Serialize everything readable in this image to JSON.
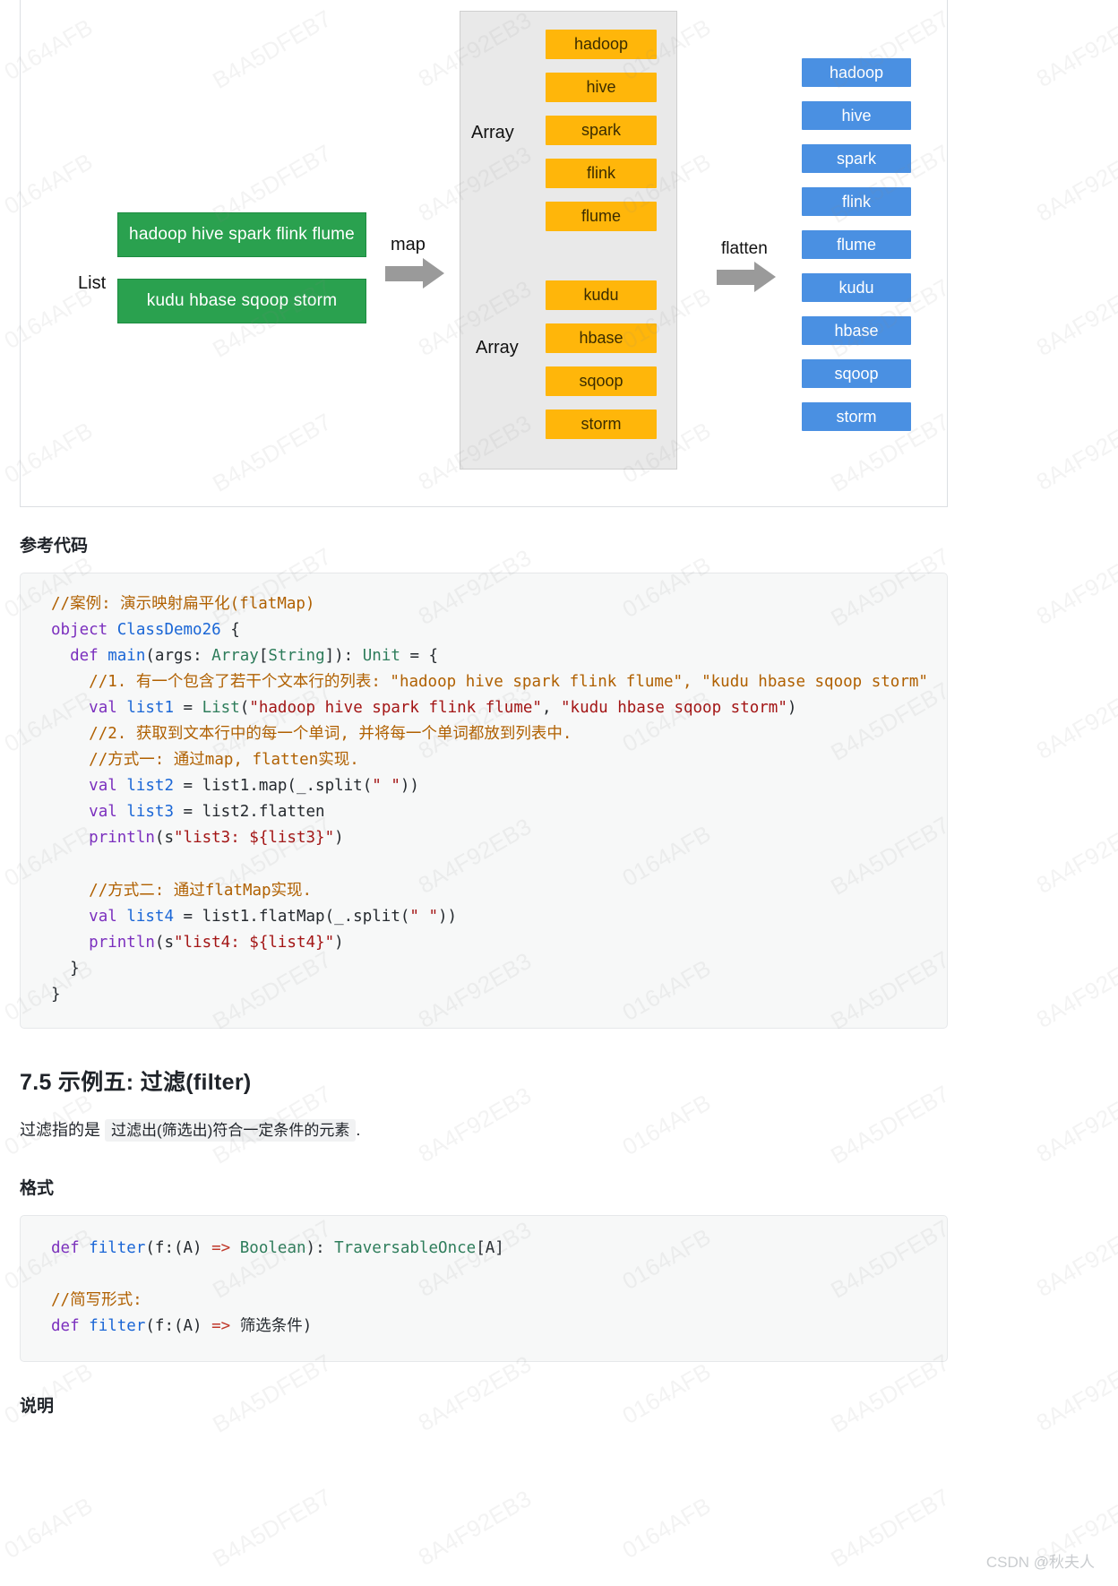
{
  "diagram": {
    "list_label": "List",
    "array_label_top": "Array",
    "array_label_bottom": "Array",
    "map_label": "map",
    "flatten_label": "flatten",
    "green_boxes": [
      "hadoop hive spark flink flume",
      "kudu hbase sqoop storm"
    ],
    "array_top_items": [
      "hadoop",
      "hive",
      "spark",
      "flink",
      "flume"
    ],
    "array_bottom_items": [
      "kudu",
      "hbase",
      "sqoop",
      "storm"
    ],
    "flattened_items": [
      "hadoop",
      "hive",
      "spark",
      "flink",
      "flume",
      "kudu",
      "hbase",
      "sqoop",
      "storm"
    ],
    "colors": {
      "green": "#2aa14f",
      "orange": "#ffb60a",
      "blue": "#4a90e2",
      "panel": "#e9e9e9",
      "arrow": "#9a9a9a"
    }
  },
  "sections": {
    "reference_code_heading": "参考代码",
    "filter_section_heading": "7.5 示例五: 过滤(filter)",
    "filter_desc_before": "过滤指的是",
    "filter_desc_highlight": "过滤出(筛选出)符合一定条件的元素",
    "filter_desc_after": ".",
    "format_heading": "格式",
    "explain_heading": "说明"
  },
  "code1": {
    "lines": [
      [
        {
          "t": "//案例: 演示映射扁平化(flatMap)",
          "c": "cmt"
        }
      ],
      [
        {
          "t": "object ",
          "c": "kw"
        },
        {
          "t": "ClassDemo26",
          "c": "fn"
        },
        {
          "t": " {",
          "c": "pl"
        }
      ],
      [
        {
          "t": "  def ",
          "c": "kw"
        },
        {
          "t": "main",
          "c": "fn"
        },
        {
          "t": "(args: ",
          "c": "pl"
        },
        {
          "t": "Array",
          "c": "typ"
        },
        {
          "t": "[",
          "c": "pl"
        },
        {
          "t": "String",
          "c": "typ"
        },
        {
          "t": "]): ",
          "c": "pl"
        },
        {
          "t": "Unit",
          "c": "typ"
        },
        {
          "t": " = {",
          "c": "pl"
        }
      ],
      [
        {
          "t": "    //1. 有一个包含了若干个文本行的列表: \"hadoop hive spark flink flume\", \"kudu hbase sqoop storm\"",
          "c": "cmt"
        }
      ],
      [
        {
          "t": "    ",
          "c": "pl"
        },
        {
          "t": "val ",
          "c": "kw"
        },
        {
          "t": "list1",
          "c": "fn"
        },
        {
          "t": " = ",
          "c": "pl"
        },
        {
          "t": "List",
          "c": "typ"
        },
        {
          "t": "(",
          "c": "pl"
        },
        {
          "t": "\"hadoop hive spark flink flume\"",
          "c": "str"
        },
        {
          "t": ", ",
          "c": "pl"
        },
        {
          "t": "\"kudu hbase sqoop storm\"",
          "c": "str"
        },
        {
          "t": ")",
          "c": "pl"
        }
      ],
      [
        {
          "t": "    //2. 获取到文本行中的每一个单词, 并将每一个单词都放到列表中.",
          "c": "cmt"
        }
      ],
      [
        {
          "t": "    //方式一: 通过map, flatten实现.",
          "c": "cmt"
        }
      ],
      [
        {
          "t": "    ",
          "c": "pl"
        },
        {
          "t": "val ",
          "c": "kw"
        },
        {
          "t": "list2",
          "c": "fn"
        },
        {
          "t": " = list1.map(_.split(",
          "c": "pl"
        },
        {
          "t": "\" \"",
          "c": "str"
        },
        {
          "t": "))",
          "c": "pl"
        }
      ],
      [
        {
          "t": "    ",
          "c": "pl"
        },
        {
          "t": "val ",
          "c": "kw"
        },
        {
          "t": "list3",
          "c": "fn"
        },
        {
          "t": " = list2.flatten",
          "c": "pl"
        }
      ],
      [
        {
          "t": "    ",
          "c": "pl"
        },
        {
          "t": "println",
          "c": "kw"
        },
        {
          "t": "(s",
          "c": "pl"
        },
        {
          "t": "\"list3: ${list3}\"",
          "c": "str"
        },
        {
          "t": ")",
          "c": "pl"
        }
      ],
      [
        {
          "t": "",
          "c": "pl"
        }
      ],
      [
        {
          "t": "    //方式二: 通过flatMap实现.",
          "c": "cmt"
        }
      ],
      [
        {
          "t": "    ",
          "c": "pl"
        },
        {
          "t": "val ",
          "c": "kw"
        },
        {
          "t": "list4",
          "c": "fn"
        },
        {
          "t": " = list1.flatMap(_.split(",
          "c": "pl"
        },
        {
          "t": "\" \"",
          "c": "str"
        },
        {
          "t": "))",
          "c": "pl"
        }
      ],
      [
        {
          "t": "    ",
          "c": "pl"
        },
        {
          "t": "println",
          "c": "kw"
        },
        {
          "t": "(s",
          "c": "pl"
        },
        {
          "t": "\"list4: ${list4}\"",
          "c": "str"
        },
        {
          "t": ")",
          "c": "pl"
        }
      ],
      [
        {
          "t": "  }",
          "c": "pl"
        }
      ],
      [
        {
          "t": "}",
          "c": "pl"
        }
      ]
    ]
  },
  "code2": {
    "lines": [
      [
        {
          "t": "def ",
          "c": "kw"
        },
        {
          "t": "filter",
          "c": "fn"
        },
        {
          "t": "(f:(A) ",
          "c": "pl"
        },
        {
          "t": "=>",
          "c": "op"
        },
        {
          "t": " ",
          "c": "pl"
        },
        {
          "t": "Boolean",
          "c": "typ"
        },
        {
          "t": "): ",
          "c": "pl"
        },
        {
          "t": "TraversableOnce",
          "c": "typ"
        },
        {
          "t": "[A]",
          "c": "pl"
        }
      ],
      [
        {
          "t": "",
          "c": "pl"
        }
      ],
      [
        {
          "t": "//简写形式:",
          "c": "cmt"
        }
      ],
      [
        {
          "t": "def ",
          "c": "kw"
        },
        {
          "t": "filter",
          "c": "fn"
        },
        {
          "t": "(f:(A) ",
          "c": "pl"
        },
        {
          "t": "=>",
          "c": "op"
        },
        {
          "t": " 筛选条件)",
          "c": "pl"
        }
      ]
    ]
  },
  "footer": {
    "watermark": "CSDN @秋夫人"
  }
}
